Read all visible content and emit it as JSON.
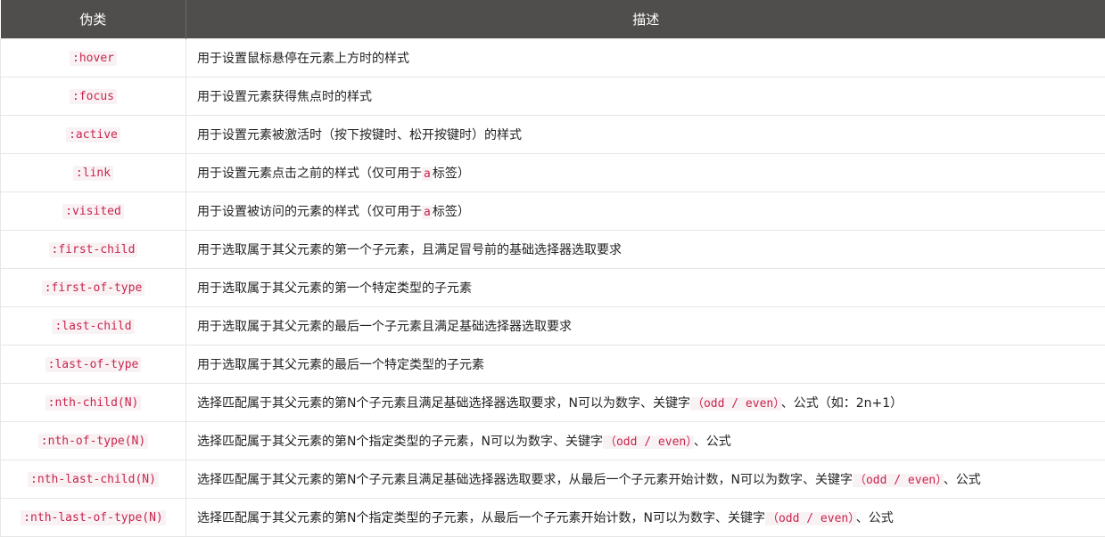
{
  "table": {
    "headers": [
      "伪类",
      "描述"
    ],
    "rows": [
      {
        "selector": ":hover",
        "desc": [
          {
            "t": "用于设置鼠标悬停在元素上方时的样式"
          }
        ]
      },
      {
        "selector": ":focus",
        "desc": [
          {
            "t": "用于设置元素获得焦点时的样式"
          }
        ]
      },
      {
        "selector": ":active",
        "desc": [
          {
            "t": "用于设置元素被激活时（按下按键时、松开按键时）的样式"
          }
        ]
      },
      {
        "selector": ":link",
        "desc": [
          {
            "t": "用于设置元素点击之前的样式（仅可用于"
          },
          {
            "c": "a"
          },
          {
            "t": "标签）"
          }
        ]
      },
      {
        "selector": ":visited",
        "desc": [
          {
            "t": "用于设置被访问的元素的样式（仅可用于"
          },
          {
            "c": "a"
          },
          {
            "t": "标签）"
          }
        ]
      },
      {
        "selector": ":first-child",
        "desc": [
          {
            "t": "用于选取属于其父元素的第一个子元素，且满足冒号前的基础选择器选取要求"
          }
        ]
      },
      {
        "selector": ":first-of-type",
        "desc": [
          {
            "t": "用于选取属于其父元素的第一个特定类型的子元素"
          }
        ]
      },
      {
        "selector": ":last-child",
        "desc": [
          {
            "t": "用于选取属于其父元素的最后一个子元素且满足基础选择器选取要求"
          }
        ]
      },
      {
        "selector": ":last-of-type",
        "desc": [
          {
            "t": "用于选取属于其父元素的最后一个特定类型的子元素"
          }
        ]
      },
      {
        "selector": ":nth-child(N)",
        "desc": [
          {
            "t": "选择匹配属于其父元素的第N个子元素且满足基础选择器选取要求，N可以为数字、关键字"
          },
          {
            "c": "（odd / even）"
          },
          {
            "t": "、公式（如：2n+1）"
          }
        ]
      },
      {
        "selector": ":nth-of-type(N)",
        "desc": [
          {
            "t": "选择匹配属于其父元素的第N个指定类型的子元素，N可以为数字、关键字"
          },
          {
            "c": "（odd / even）"
          },
          {
            "t": "、公式"
          }
        ]
      },
      {
        "selector": ":nth-last-child(N)",
        "desc": [
          {
            "t": "选择匹配属于其父元素的第N个子元素且满足基础选择器选取要求，从最后一个子元素开始计数，N可以为数字、关键字"
          },
          {
            "c": "（odd / even）"
          },
          {
            "t": "、公式"
          }
        ]
      },
      {
        "selector": ":nth-last-of-type(N)",
        "desc": [
          {
            "t": "选择匹配属于其父元素的第N个指定类型的子元素，从最后一个子元素开始计数，N可以为数字、关键字"
          },
          {
            "c": "（odd / even）"
          },
          {
            "t": "、公式"
          }
        ]
      }
    ]
  },
  "colors": {
    "header_bg": "#504e4c",
    "code_text": "#c7254e",
    "code_bg": "#f9f2f4",
    "border": "#e6e6e6"
  }
}
